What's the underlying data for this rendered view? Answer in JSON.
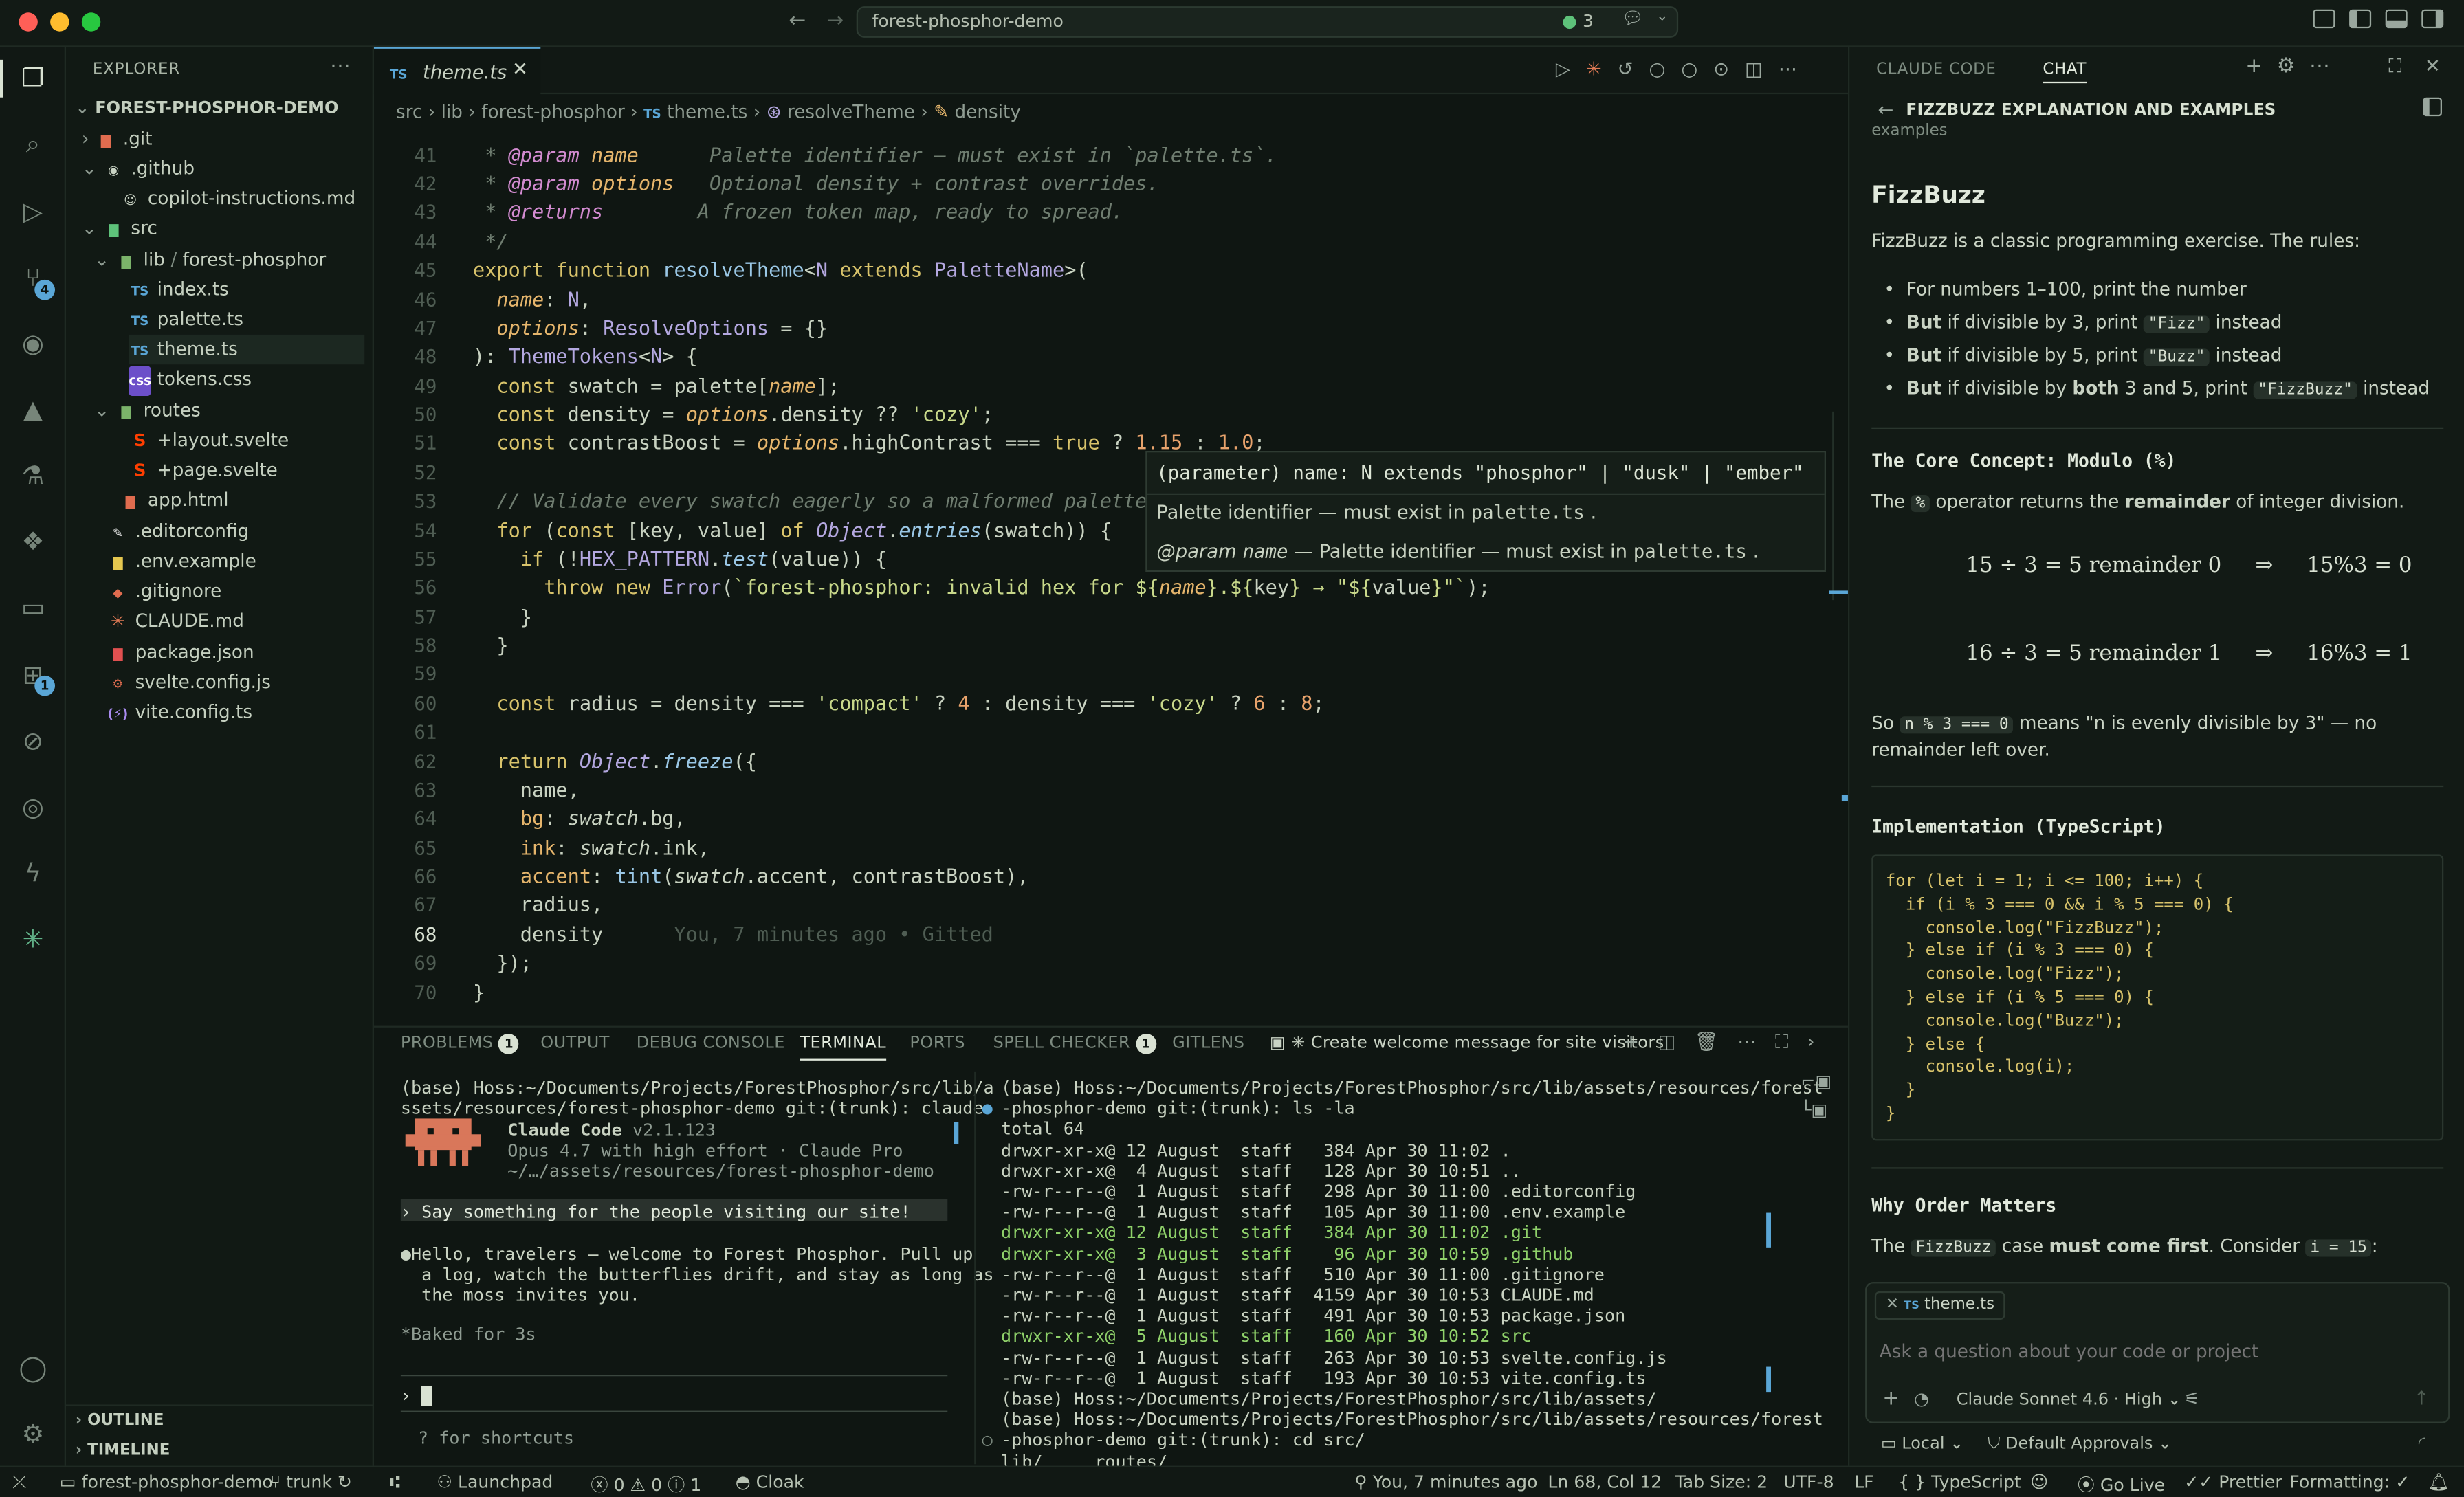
{
  "colors": {
    "accent": "#5aa6d6",
    "bg": "#0f1612",
    "keyword": "#d8c36b",
    "function": "#9ac7e5",
    "string": "#c8d88a"
  },
  "titlebar": {
    "search": "forest-phosphor-demo",
    "count": "3"
  },
  "explorer": {
    "title": "EXPLORER",
    "root": "FOREST-PHOSPHOR-DEMO",
    "items": [
      ".git",
      ".github",
      "copilot-instructions.md",
      "src",
      "lib",
      "forest-phosphor",
      "index.ts",
      "palette.ts",
      "theme.ts",
      "tokens.css",
      "routes",
      "+layout.svelte",
      "+page.svelte",
      "app.html",
      ".editorconfig",
      ".env.example",
      ".gitignore",
      "CLAUDE.md",
      "package.json",
      "svelte.config.js",
      "vite.config.ts"
    ],
    "outline": "OUTLINE",
    "timeline": "TIMELINE"
  },
  "activity_badges": {
    "scm": "4",
    "ext": "1"
  },
  "editor": {
    "tab": "theme.ts",
    "breadcrumb": [
      "src",
      "lib",
      "forest-phosphor",
      "theme.ts",
      "resolveTheme",
      "density"
    ],
    "lines": {
      "l41": "41",
      "l42": "42",
      "l43": "43",
      "l44": "44",
      "l45": "45",
      "l46": "46",
      "l47": "47",
      "l48": "48",
      "l49": "49",
      "l50": "50",
      "l51": "51",
      "l52": "52",
      "l53": "53",
      "l54": "54",
      "l55": "55",
      "l56": "56",
      "l57": "57",
      "l58": "58",
      "l59": "59",
      "l60": "60",
      "l61": "61",
      "l62": "62",
      "l63": "63",
      "l64": "64",
      "l65": "65",
      "l66": "66",
      "l67": "67",
      "l68": "68",
      "l69": "69",
      "l70": "70"
    },
    "blame": "You, 7 minutes ago • Gitted",
    "hover": {
      "sig": "(parameter) name: N extends \"phosphor\" | \"dusk\" | \"ember\"",
      "desc": "Palette identifier — must exist in",
      "file": "palette.ts",
      "param": "@param",
      "pname": "name",
      "pdesc": "— Palette identifier — must exist in"
    }
  },
  "panel": {
    "tabs": [
      "PROBLEMS",
      "OUTPUT",
      "DEBUG CONSOLE",
      "TERMINAL",
      "PORTS",
      "SPELL CHECKER",
      "GITLENS"
    ],
    "problems_count": "1",
    "spell_count": "1",
    "task": "Create welcome message for site visitors",
    "left_term": {
      "prompt1": "(base) Hoss:~/Documents/Projects/ForestPhosphor/src/lib/a",
      "prompt2": "ssets/resources/forest-phosphor-demo git:(trunk): claude",
      "app": "Claude Code",
      "ver": "v2.1.123",
      "model": "Opus 4.7 with high effort · Claude Pro",
      "path": "~/…/assets/resources/forest-phosphor-demo",
      "user": "› Say something for the people visiting our site!",
      "reply1": "●Hello, travelers — welcome to Forest Phosphor. Pull up",
      "reply2": "  a log, watch the butterflies drift, and stay as long as",
      "reply3": "  the moss invites you.",
      "baked": "*Baked for 3s",
      "input": "›",
      "hint": "? for shortcuts"
    },
    "right_term": [
      "(base) Hoss:~/Documents/Projects/ForestPhosphor/src/lib/assets/resources/forest",
      "-phosphor-demo git:(trunk): ls -la",
      "total 64",
      "drwxr-xr-x@ 12 August  staff   384 Apr 30 11:02 .",
      "drwxr-xr-x@  4 August  staff   128 Apr 30 10:51 ..",
      "-rw-r--r--@  1 August  staff   298 Apr 30 11:00 .editorconfig",
      "-rw-r--r--@  1 August  staff   105 Apr 30 11:00 .env.example",
      "drwxr-xr-x@ 12 August  staff   384 Apr 30 11:02 .git",
      "drwxr-xr-x@  3 August  staff    96 Apr 30 10:59 .github",
      "-rw-r--r--@  1 August  staff   510 Apr 30 11:00 .gitignore",
      "-rw-r--r--@  1 August  staff  4159 Apr 30 10:53 CLAUDE.md",
      "-rw-r--r--@  1 August  staff   491 Apr 30 10:53 package.json",
      "drwxr-xr-x@  5 August  staff   160 Apr 30 10:52 src",
      "-rw-r--r--@  1 August  staff   263 Apr 30 10:53 svelte.config.js",
      "-rw-r--r--@  1 August  staff   193 Apr 30 10:53 vite.config.ts",
      "(base) Hoss:~/Documents/Projects/ForestPhosphor/src/lib/assets/",
      "(base) Hoss:~/Documents/Projects/ForestPhosphor/src/lib/assets/resources/forest",
      "-phosphor-demo git:(trunk): cd src/",
      "lib/     routes/"
    ]
  },
  "chat": {
    "tabs": [
      "CLAUDE CODE",
      "CHAT"
    ],
    "thread": "FIZZBUZZ EXPLANATION AND EXAMPLES",
    "sub": "examples",
    "h1": "FizzBuzz",
    "intro": "FizzBuzz is a classic programming exercise. The rules:",
    "b1": "For numbers 1–100, print the number",
    "b2a": "But",
    "b2b": " if divisible by 3, print ",
    "b2c": "\"Fizz\"",
    "b2d": " instead",
    "b3a": "But",
    "b3b": " if divisible by 5, print ",
    "b3c": "\"Buzz\"",
    "b3d": " instead",
    "b4a": "But",
    "b4b": " if divisible by ",
    "b4c": "both",
    "b4d": " 3 and 5, print ",
    "b4e": "\"FizzBuzz\"",
    "b4f": " instead",
    "h2": "The Core Concept: Modulo (%)",
    "p1a": "The ",
    "p1b": "%",
    "p1c": " operator returns the ",
    "p1d": "remainder",
    "p1e": " of integer division.",
    "m1": "15 ÷ 3 = 5 remainder 0     ⇒     15%3 = 0",
    "m2": "16 ÷ 3 = 5 remainder 1     ⇒     16%3 = 1",
    "p2a": "So ",
    "p2b": "n % 3 === 0",
    "p2c": " means \"n is evenly divisible by 3\" — no",
    "p2d": "remainder left over.",
    "h3": "Implementation (TypeScript)",
    "code": [
      "for (let i = 1; i <= 100; i++) {",
      "  if (i % 3 === 0 && i % 5 === 0) {",
      "    console.log(\"FizzBuzz\");",
      "  } else if (i % 3 === 0) {",
      "    console.log(\"Fizz\");",
      "  } else if (i % 5 === 0) {",
      "    console.log(\"Buzz\");",
      "  } else {",
      "    console.log(i);",
      "  }",
      "}"
    ],
    "h4": "Why Order Matters",
    "p3a": "The ",
    "p3b": "FizzBuzz",
    "p3c": " case ",
    "p3d": "must come first",
    "p3e": ". Consider ",
    "p3f": "i = 15",
    ":": "",
    "attach": "theme.ts",
    "placeholder": "Ask a question about your code or project",
    "model": "Claude Sonnet 4.6 · High",
    "local": "Local",
    "approvals": "Default Approvals"
  },
  "status": {
    "repo": "forest-phosphor-demo",
    "branch": "trunk",
    "launchpad": "Launchpad",
    "errors": "0",
    "warnings": "0",
    "info": "1",
    "cloak": "Cloak",
    "blame": "You, 7 minutes ago",
    "pos": "Ln 68, Col 12",
    "tab": "Tab Size: 2",
    "enc": "UTF-8",
    "eol": "LF",
    "lang": "TypeScript",
    "golive": "Go Live",
    "prettier": "Prettier",
    "formatting": "Formatting: ✓"
  }
}
